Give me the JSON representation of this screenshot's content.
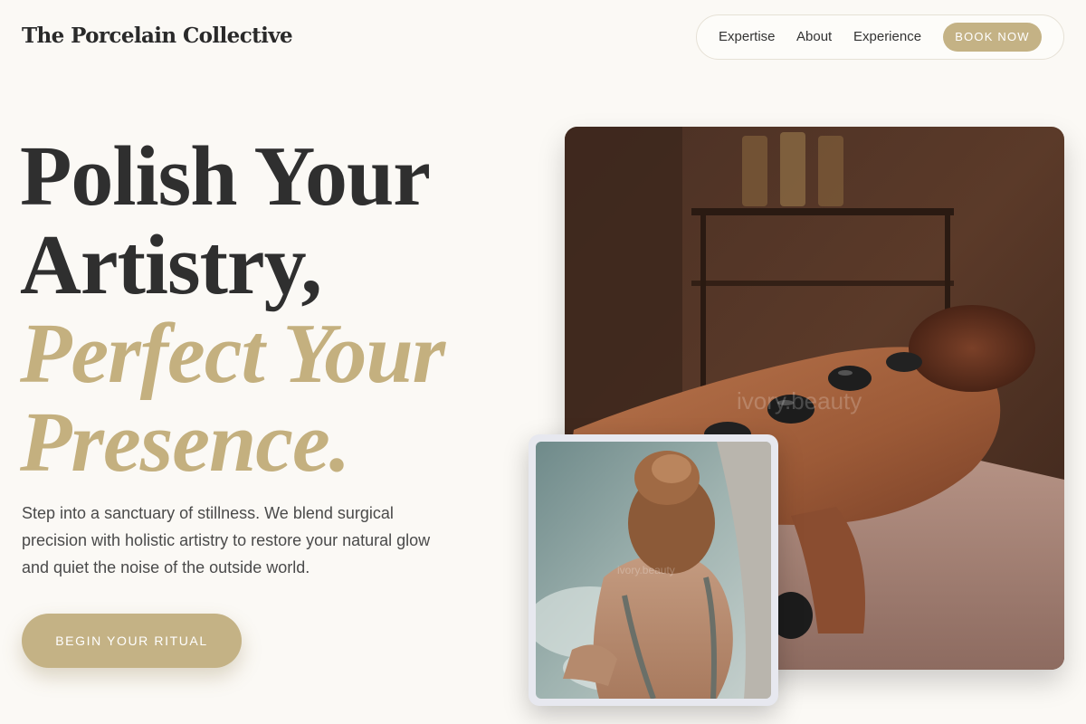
{
  "brand": {
    "name": "The Porcelain Collective"
  },
  "nav": {
    "links": [
      "Expertise",
      "About",
      "Experience"
    ],
    "book_label": "BOOK NOW"
  },
  "hero": {
    "line1": "Polish Your",
    "line2": "Artistry,",
    "line3": "Perfect Your",
    "line4": "Presence.",
    "description": "Step into a sanctuary of stillness. We blend surgical precision with holistic artistry to restore your natural glow and quiet the noise of the outside world.",
    "cta_label": "BEGIN YOUR RITUAL"
  },
  "images": {
    "main_watermark": "ivory.beauty",
    "small_watermark": "ivory.beauty"
  },
  "colors": {
    "accent": "#c4b285",
    "accent_text": "#c4b07f",
    "background": "#fbf9f5",
    "text": "#2f2f2f"
  }
}
